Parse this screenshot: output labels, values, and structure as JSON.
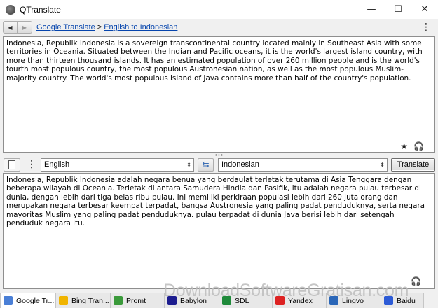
{
  "window": {
    "title": "QTranslate",
    "minimize": "—",
    "maximize": "☐",
    "close": "✕"
  },
  "nav": {
    "back": "◀",
    "forward": "▶",
    "crumb_service": "Google Translate",
    "crumb_sep": ">",
    "crumb_direction": "English to Indonesian",
    "menu": "⋮"
  },
  "source": {
    "text": "Indonesia, Republik Indonesia is a sovereign transcontinental country located mainly in Southeast Asia with some territories in Oceania. Situated between the Indian and Pacific oceans, it is the world's largest island country, with more than thirteen thousand islands. It has an estimated population of over 260 million people and is the world's fourth most populous country, the most populous Austronesian nation, as well as the most populous Muslim-majority country. The world's most populous island of Java contains more than half of the country's population.",
    "favorite_icon": "★",
    "listen_icon": "🎧"
  },
  "splitter": "•••",
  "toolbar": {
    "menu": "⋮",
    "source_language": "English",
    "swap_icon": "⇆",
    "target_language": "Indonesian",
    "dropdown_arrow": "⬍",
    "translate_label": "Translate"
  },
  "target": {
    "text": "Indonesia, Republik Indonesia adalah negara benua yang berdaulat terletak terutama di Asia Tenggara dengan beberapa wilayah di Oceania. Terletak di antara Samudera Hindia dan Pasifik, itu adalah negara pulau terbesar di dunia, dengan lebih dari tiga belas ribu pulau. Ini memiliki perkiraan populasi lebih dari 260 juta orang dan merupakan negara terbesar keempat terpadat, bangsa Austronesia yang paling padat penduduknya, serta negara mayoritas Muslim yang paling padat penduduknya. pulau terpadat di dunia Java berisi lebih dari setengah penduduk negara itu.",
    "listen_icon": "🎧"
  },
  "tabs": [
    {
      "label": "Google Tr...",
      "icon_color": "#4a7fd6",
      "active": true
    },
    {
      "label": "Bing Tran...",
      "icon_color": "#f0b400"
    },
    {
      "label": "Promt",
      "icon_color": "#3a9a3a"
    },
    {
      "label": "Babylon",
      "icon_color": "#1d1d8f"
    },
    {
      "label": "SDL",
      "icon_color": "#1f8a3a"
    },
    {
      "label": "Yandex",
      "icon_color": "#d22"
    },
    {
      "label": "Lingvo",
      "icon_color": "#2b67b8"
    },
    {
      "label": "Baidu",
      "icon_color": "#2d5bd6"
    }
  ],
  "watermark": "DownloadSoftwareGratisan.com",
  "colors": {
    "link": "#0645ad",
    "background": "#f0f0f0"
  }
}
